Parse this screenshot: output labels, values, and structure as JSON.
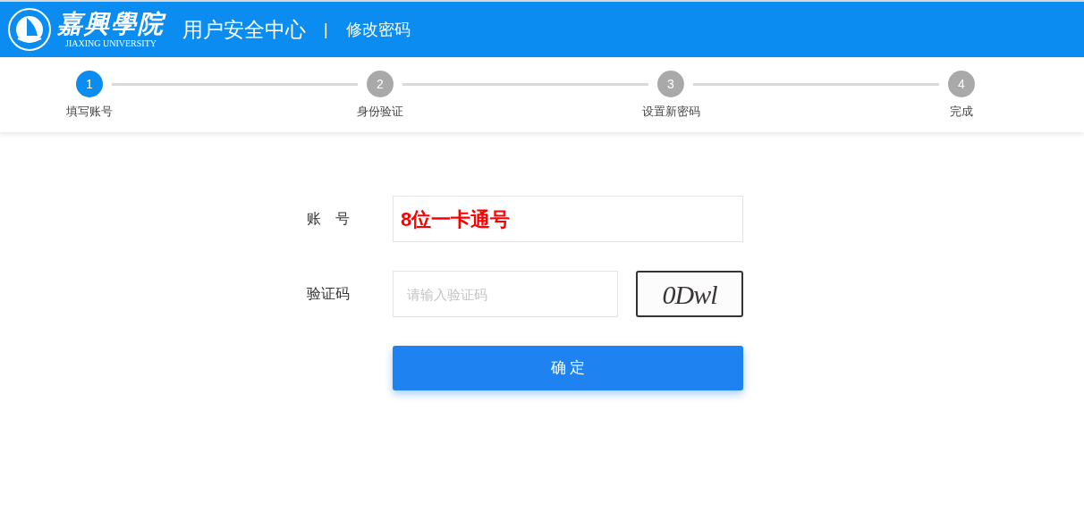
{
  "header": {
    "logo_name": "嘉興學院",
    "logo_subtitle": "JIAXING UNIVERSITY",
    "title": "用户安全中心",
    "separator": "|",
    "subtitle": "修改密码"
  },
  "steps": [
    {
      "number": "1",
      "label": "填写账号",
      "selected": true
    },
    {
      "number": "2",
      "label": "身份验证",
      "selected": false
    },
    {
      "number": "3",
      "label": "设置新密码",
      "selected": false
    },
    {
      "number": "4",
      "label": "完成",
      "selected": false
    }
  ],
  "form": {
    "account": {
      "label": "账　号",
      "value": "8位一卡通号"
    },
    "captcha": {
      "label": "验证码",
      "placeholder": "请输入验证码",
      "code": "0Dwl"
    },
    "submit": "确 定"
  }
}
